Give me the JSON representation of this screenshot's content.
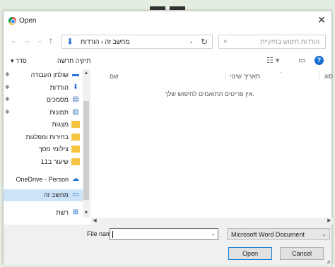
{
  "window": {
    "title": "Open"
  },
  "nav": {
    "back": "←",
    "forward": "→",
    "recent": "⌄",
    "up": "↑",
    "address_path": "מחשב זה  ›  הורדות",
    "address_dropdown": "⌄",
    "refresh": "↻",
    "search_placeholder": "הורדות חיפוש בתיקיית"
  },
  "toolbar": {
    "organize": "סדר  ▾",
    "new_folder": "תיקיה חדשה",
    "help": "?"
  },
  "sidebar": {
    "items": [
      {
        "label": "שולחן העבודה",
        "icon": "desktop-icon",
        "pinned": true
      },
      {
        "label": "הורדות",
        "icon": "downloads-icon",
        "pinned": true
      },
      {
        "label": "מסמכים",
        "icon": "documents-icon",
        "pinned": true
      },
      {
        "label": "תמונות",
        "icon": "pictures-icon",
        "pinned": true
      },
      {
        "label": "מצגות",
        "icon": "folder-icon",
        "pinned": false
      },
      {
        "label": "בחירות ומפלגות",
        "icon": "folder-icon",
        "pinned": false
      },
      {
        "label": "צילומי מסך",
        "icon": "folder-icon",
        "pinned": false
      },
      {
        "label": "שיעור ב11",
        "icon": "folder-icon",
        "pinned": false
      },
      {
        "label": "OneDrive - Person",
        "icon": "onedrive-icon",
        "pinned": false
      },
      {
        "label": "מחשב זה",
        "icon": "this-pc-icon",
        "pinned": false,
        "selected": true
      },
      {
        "label": "רשת",
        "icon": "network-icon",
        "pinned": false
      }
    ]
  },
  "columns": {
    "name": "שם",
    "date": "תאריך שינוי",
    "type": "סוג"
  },
  "empty_message": ".אין פריטים התואמים לחיפוש שלך",
  "footer": {
    "file_name_label": "File name:",
    "file_name_value": "",
    "file_type": "Microsoft Word Document",
    "open_label": "Open",
    "cancel_label": "Cancel"
  },
  "colors": {
    "accent": "#0078d7",
    "selected": "#cce4f7",
    "folder": "#f5c542"
  }
}
